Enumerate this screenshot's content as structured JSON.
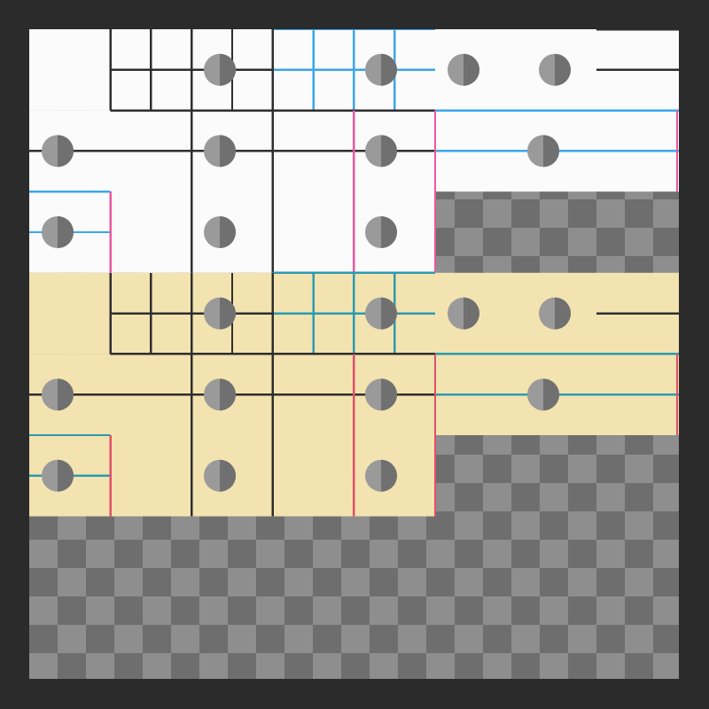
{
  "colors": {
    "window_background": "#2b2b2b",
    "checker_light": "#8e8e8e",
    "checker_dark": "#6e6e6e",
    "tile_white": "#fbfbfb",
    "tile_cream": "#f3e3b0",
    "line_dark": "#2e2e2e",
    "line_blue": "#3aa6ea",
    "line_teal": "#2a9bb0",
    "line_pink": "#e85aa0",
    "line_red": "#e0506a",
    "knob_light": "#9a9a9a",
    "knob_dark": "#707070"
  },
  "tileset": {
    "grid_columns": 8,
    "grid_rows": 8,
    "variants": [
      {
        "name": "white",
        "fill": "tile_white",
        "blue_line": "line_blue",
        "pink_line": "line_pink"
      },
      {
        "name": "cream",
        "fill": "tile_cream",
        "blue_line": "line_teal",
        "pink_line": "line_red"
      }
    ]
  }
}
